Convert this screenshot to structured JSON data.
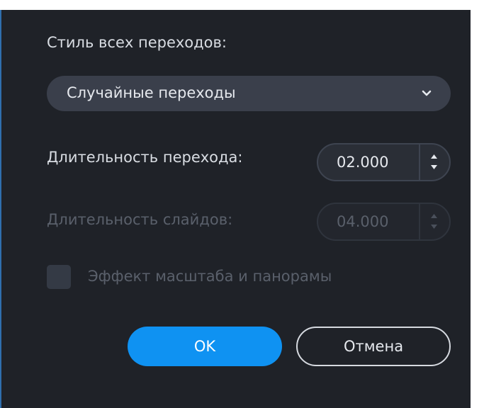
{
  "dialog": {
    "transition_style_label": "Стиль всех переходов:",
    "transition_style_value": "Случайные переходы",
    "transition_duration_label": "Длительность перехода:",
    "transition_duration_value": "02.000",
    "slide_duration_label": "Длительность слайдов:",
    "slide_duration_value": "04.000",
    "pan_zoom_label": "Эффект масштаба и панорамы",
    "ok_label": "OK",
    "cancel_label": "Отмена"
  },
  "colors": {
    "background": "#1f2228",
    "accent": "#0f92f2",
    "field": "#3a3f4b",
    "text": "#d9dde3",
    "disabled_text": "#5a606b"
  },
  "icons": {
    "dropdown": "chevron-down-icon",
    "spin_up": "arrow-up-icon",
    "spin_down": "arrow-down-icon"
  }
}
